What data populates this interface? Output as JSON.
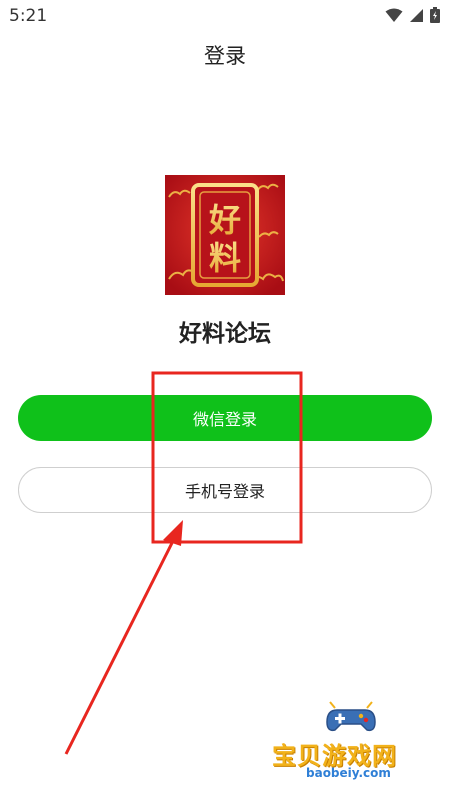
{
  "status_bar": {
    "time": "5:21",
    "icons": [
      "wifi-icon",
      "signal-icon",
      "battery-icon"
    ]
  },
  "header": {
    "title": "登录"
  },
  "app": {
    "logo_text": "好料",
    "name": "好料论坛"
  },
  "buttons": {
    "wechat_login": "微信登录",
    "phone_login": "手机号登录"
  },
  "watermark": {
    "title": "宝贝游戏网",
    "url": "baobeiy.com"
  },
  "colors": {
    "wechat_green": "#0fc11a",
    "annotation_red": "#e8261f",
    "logo_red": "#c8141b",
    "logo_gold": "#f2c24a"
  }
}
